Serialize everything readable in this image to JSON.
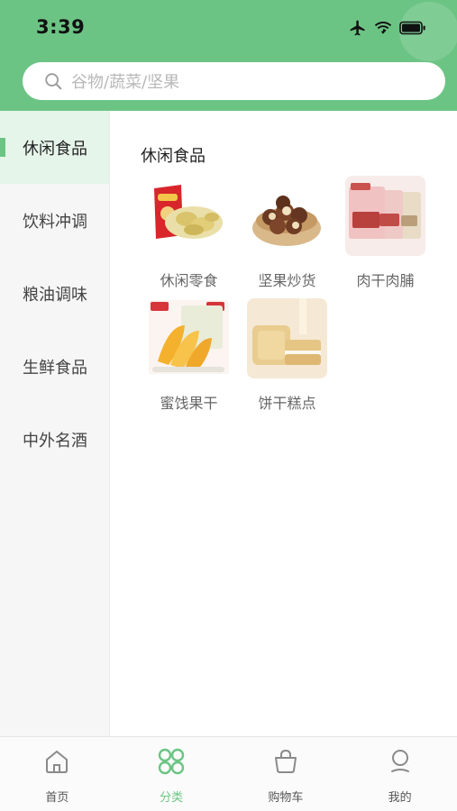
{
  "status_bar": {
    "time": "3:39"
  },
  "search": {
    "placeholder": "谷物/蔬菜/坚果"
  },
  "sidebar": {
    "items": [
      {
        "label": "休闲食品",
        "active": true
      },
      {
        "label": "饮料冲调"
      },
      {
        "label": "粮油调味"
      },
      {
        "label": "生鲜食品"
      },
      {
        "label": "中外名酒"
      }
    ]
  },
  "main": {
    "section_title": "休闲食品",
    "categories": [
      {
        "label": "休闲零食",
        "image": "potato-chips"
      },
      {
        "label": "坚果炒货",
        "image": "macadamia-nuts"
      },
      {
        "label": "肉干肉脯",
        "image": "jerky-packs"
      },
      {
        "label": "蜜饯果干",
        "image": "dried-mango"
      },
      {
        "label": "饼干糕点",
        "image": "cream-biscuits"
      }
    ]
  },
  "tabbar": {
    "tabs": [
      {
        "label": "首页",
        "icon": "home-icon"
      },
      {
        "label": "分类",
        "icon": "category-icon",
        "active": true
      },
      {
        "label": "购物车",
        "icon": "cart-icon"
      },
      {
        "label": "我的",
        "icon": "profile-icon"
      }
    ]
  },
  "colors": {
    "accent": "#6cc484",
    "active_bg": "#e6f5ea",
    "sidebar_bg": "#f6f6f6"
  }
}
